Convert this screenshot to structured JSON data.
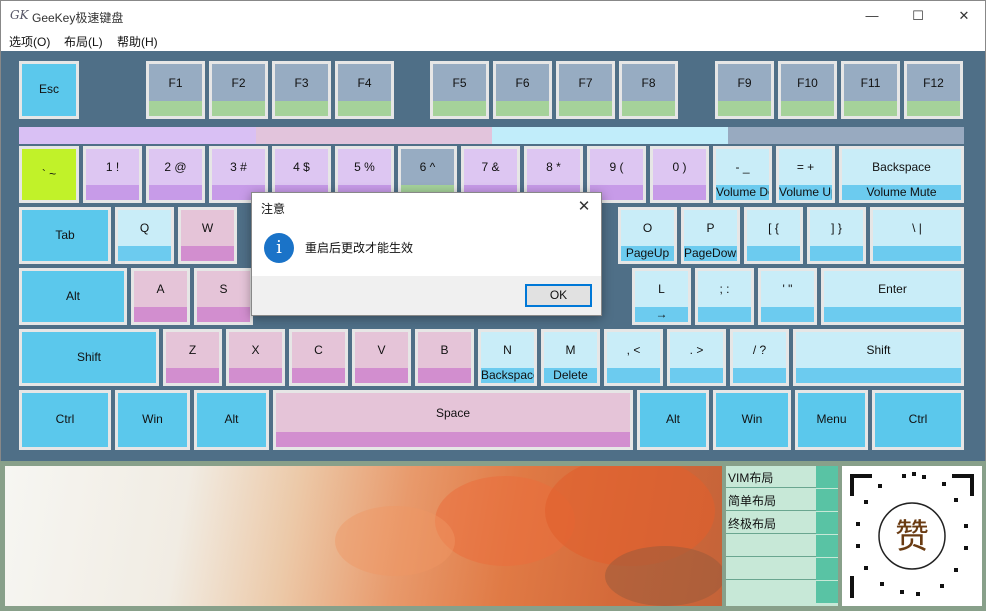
{
  "window": {
    "app_icon": "GK",
    "title": "GeeKey极速键盘",
    "minimize": "—",
    "maximize": "☐",
    "close": "✕"
  },
  "menu": [
    "选项(O)",
    "布局(L)",
    "帮助(H)"
  ],
  "keys": {
    "esc": {
      "main": "Esc",
      "sub": ""
    },
    "f1": {
      "main": "F1",
      "sub": ""
    },
    "f2": {
      "main": "F2",
      "sub": ""
    },
    "f3": {
      "main": "F3",
      "sub": ""
    },
    "f4": {
      "main": "F4",
      "sub": ""
    },
    "f5": {
      "main": "F5",
      "sub": ""
    },
    "f6": {
      "main": "F6",
      "sub": ""
    },
    "f7": {
      "main": "F7",
      "sub": ""
    },
    "f8": {
      "main": "F8",
      "sub": ""
    },
    "f9": {
      "main": "F9",
      "sub": ""
    },
    "f10": {
      "main": "F10",
      "sub": ""
    },
    "f11": {
      "main": "F11",
      "sub": ""
    },
    "f12": {
      "main": "F12",
      "sub": ""
    },
    "backtick": {
      "main": "` ~",
      "sub": ""
    },
    "d1": {
      "main": "1 !",
      "sub": ""
    },
    "d2": {
      "main": "2 @",
      "sub": ""
    },
    "d3": {
      "main": "3 #",
      "sub": ""
    },
    "d4": {
      "main": "4 $",
      "sub": ""
    },
    "d5": {
      "main": "5 %",
      "sub": ""
    },
    "d6": {
      "main": "6 ^",
      "sub": ""
    },
    "d7": {
      "main": "7 &",
      "sub": ""
    },
    "d8": {
      "main": "8 *",
      "sub": ""
    },
    "d9": {
      "main": "9 (",
      "sub": ""
    },
    "d0": {
      "main": "0 )",
      "sub": ""
    },
    "minus": {
      "main": "- _",
      "sub": "Volume Down"
    },
    "equal": {
      "main": "= +",
      "sub": "Volume Up"
    },
    "backspace": {
      "main": "Backspace",
      "sub": "Volume Mute"
    },
    "tab": {
      "main": "Tab",
      "sub": ""
    },
    "q": {
      "main": "Q",
      "sub": ""
    },
    "w": {
      "main": "W",
      "sub": ""
    },
    "o": {
      "main": "O",
      "sub": "PageUp"
    },
    "p": {
      "main": "P",
      "sub": "PageDown"
    },
    "lbracket": {
      "main": "[ {",
      "sub": ""
    },
    "rbracket": {
      "main": "] }",
      "sub": ""
    },
    "backslash": {
      "main": "\\ |",
      "sub": ""
    },
    "alt_left": {
      "main": "Alt",
      "sub": ""
    },
    "a": {
      "main": "A",
      "sub": ""
    },
    "s": {
      "main": "S",
      "sub": ""
    },
    "l": {
      "main": "L",
      "sub": "→"
    },
    "semicolon": {
      "main": "; :",
      "sub": ""
    },
    "quote": {
      "main": "' \"",
      "sub": ""
    },
    "enter": {
      "main": "Enter",
      "sub": ""
    },
    "shift_left": {
      "main": "Shift",
      "sub": ""
    },
    "z": {
      "main": "Z",
      "sub": ""
    },
    "x": {
      "main": "X",
      "sub": ""
    },
    "c": {
      "main": "C",
      "sub": ""
    },
    "v": {
      "main": "V",
      "sub": ""
    },
    "b": {
      "main": "B",
      "sub": ""
    },
    "n": {
      "main": "N",
      "sub": "Backspace"
    },
    "m": {
      "main": "M",
      "sub": "Delete"
    },
    "comma": {
      "main": ", <",
      "sub": ""
    },
    "period": {
      "main": ". >",
      "sub": ""
    },
    "slash": {
      "main": "/ ?",
      "sub": ""
    },
    "shift_right": {
      "main": "Shift",
      "sub": ""
    },
    "ctrl_left": {
      "main": "Ctrl",
      "sub": ""
    },
    "win_left": {
      "main": "Win",
      "sub": ""
    },
    "alt_left2": {
      "main": "Alt",
      "sub": ""
    },
    "space": {
      "main": "Space",
      "sub": ""
    },
    "alt_right": {
      "main": "Alt",
      "sub": ""
    },
    "win_right": {
      "main": "Win",
      "sub": ""
    },
    "menu": {
      "main": "Menu",
      "sub": ""
    },
    "ctrl_right": {
      "main": "Ctrl",
      "sub": ""
    }
  },
  "layouts": [
    "VIM布局",
    "简单布局",
    "终极布局",
    "",
    "",
    ""
  ],
  "qr_char": "赞",
  "dialog": {
    "title": "注意",
    "close": "✕",
    "icon": "i",
    "message": "重启后更改才能生效",
    "ok": "OK"
  },
  "colors": {
    "keyboard_bg": "#4f6f87",
    "accent_blue": "#0078d7",
    "modifier_key": "#5bc8ec",
    "function_key": "#97acc2",
    "mode_purple": "#d9c0f4",
    "mode_pink": "#e2c4dc",
    "mode_cyan": "#c1edfa",
    "mode_gray": "#98aac0"
  }
}
